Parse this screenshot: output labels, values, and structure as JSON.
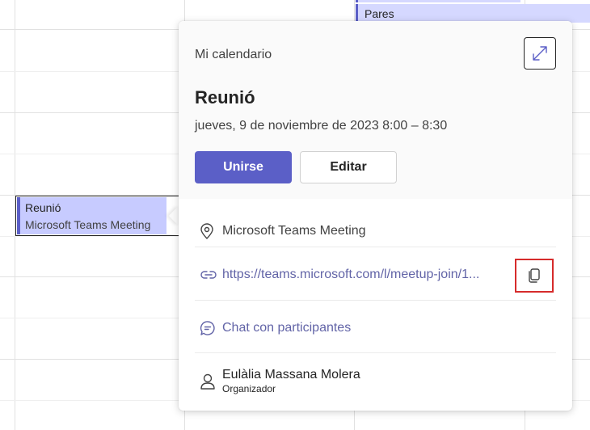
{
  "calendar": {
    "top_event_label": "Pares",
    "event_title": "Reunió",
    "event_location": "Microsoft Teams Meeting"
  },
  "popup": {
    "calendar_name": "Mi calendario",
    "title": "Reunió",
    "datetime": "jueves, 9 de noviembre de 2023 8:00 – 8:30",
    "join_label": "Unirse",
    "edit_label": "Editar",
    "location": "Microsoft Teams Meeting",
    "meeting_link": "https://teams.microsoft.com/l/meetup-join/1...",
    "chat_label": "Chat con participantes",
    "organizer_name": "Eulàlia Massana Molera",
    "organizer_role": "Organizador"
  },
  "colors": {
    "accent": "#5b5fc7",
    "event_fill": "#c7cbff",
    "link": "#6264a7",
    "highlight": "#d62b2b"
  },
  "icons": [
    "expand-icon",
    "location-pin-icon",
    "link-icon",
    "copy-icon",
    "chat-icon",
    "person-icon"
  ]
}
